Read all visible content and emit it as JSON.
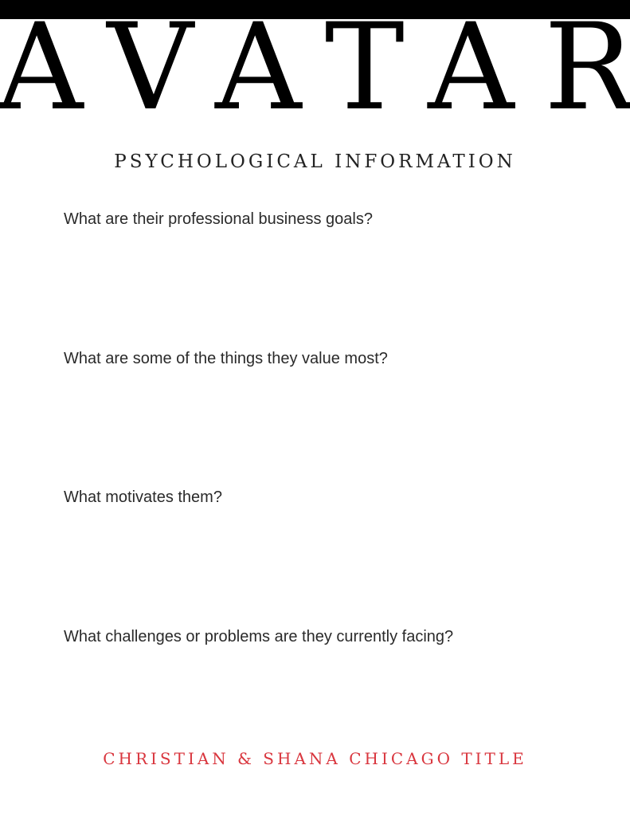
{
  "header": {
    "title": "AVATAR"
  },
  "section": {
    "title": "PSYCHOLOGICAL INFORMATION"
  },
  "questions": [
    "What are their professional business goals?",
    "What are some of the things they value most?",
    "What motivates them?",
    "What challenges or problems are they currently facing?"
  ],
  "footer": {
    "text": "CHRISTIAN & SHANA CHICAGO TITLE"
  },
  "colors": {
    "footer_accent": "#d9363e",
    "header_bar": "#000000"
  }
}
